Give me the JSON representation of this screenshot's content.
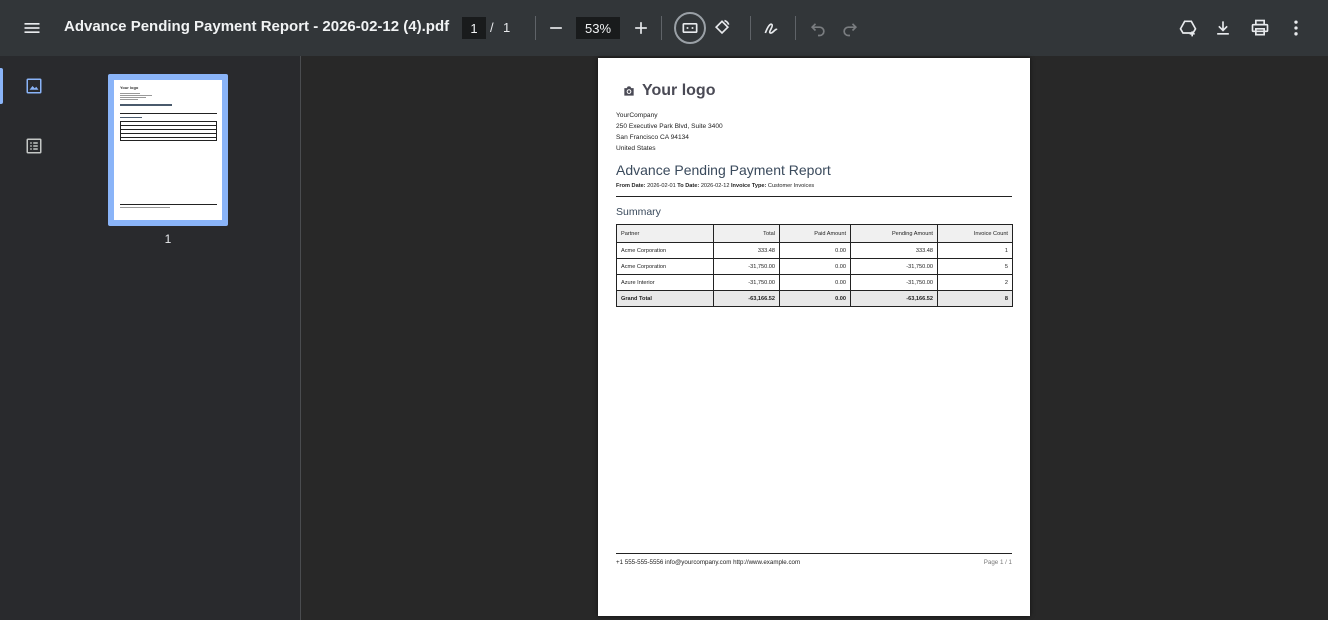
{
  "toolbar": {
    "menu_icon": "menu-icon",
    "title": "Advance Pending Payment Report - 2026-02-12 (4).pdf",
    "page_current": "1",
    "page_separator": "/",
    "page_total": "1",
    "zoom": "53%"
  },
  "sidebar": {
    "thumbnail_label": "1",
    "thumb_logo": "Your logo"
  },
  "document": {
    "logo_text": "Your logo",
    "company": {
      "name": "YourCompany",
      "address1": "250 Executive Park Blvd, Suite 3400",
      "address2": "San Francisco CA 94134",
      "country": "United States"
    },
    "report_title": "Advance Pending Payment Report",
    "filters": {
      "from_label": "From Date:",
      "from_value": "2026-02-01",
      "to_label": "To Date:",
      "to_value": "2026-02-12",
      "type_label": "Invoice Type:",
      "type_value": "Customer Invoices"
    },
    "summary_heading": "Summary",
    "table": {
      "headers": [
        "Partner",
        "Total",
        "Paid Amount",
        "Pending Amount",
        "Invoice Count"
      ],
      "rows": [
        [
          "Acme Corporation",
          "333.48",
          "0.00",
          "333.48",
          "1"
        ],
        [
          "Acme Corporation",
          "-31,750.00",
          "0.00",
          "-31,750.00",
          "5"
        ],
        [
          "Azure Interior",
          "-31,750.00",
          "0.00",
          "-31,750.00",
          "2"
        ]
      ],
      "total": [
        "Grand Total",
        "-63,166.52",
        "0.00",
        "-63,166.52",
        "8"
      ]
    },
    "footer": {
      "contact": "+1 555-555-5556 info@yourcompany.com http://www.example.com",
      "page": "Page 1 / 1"
    }
  }
}
